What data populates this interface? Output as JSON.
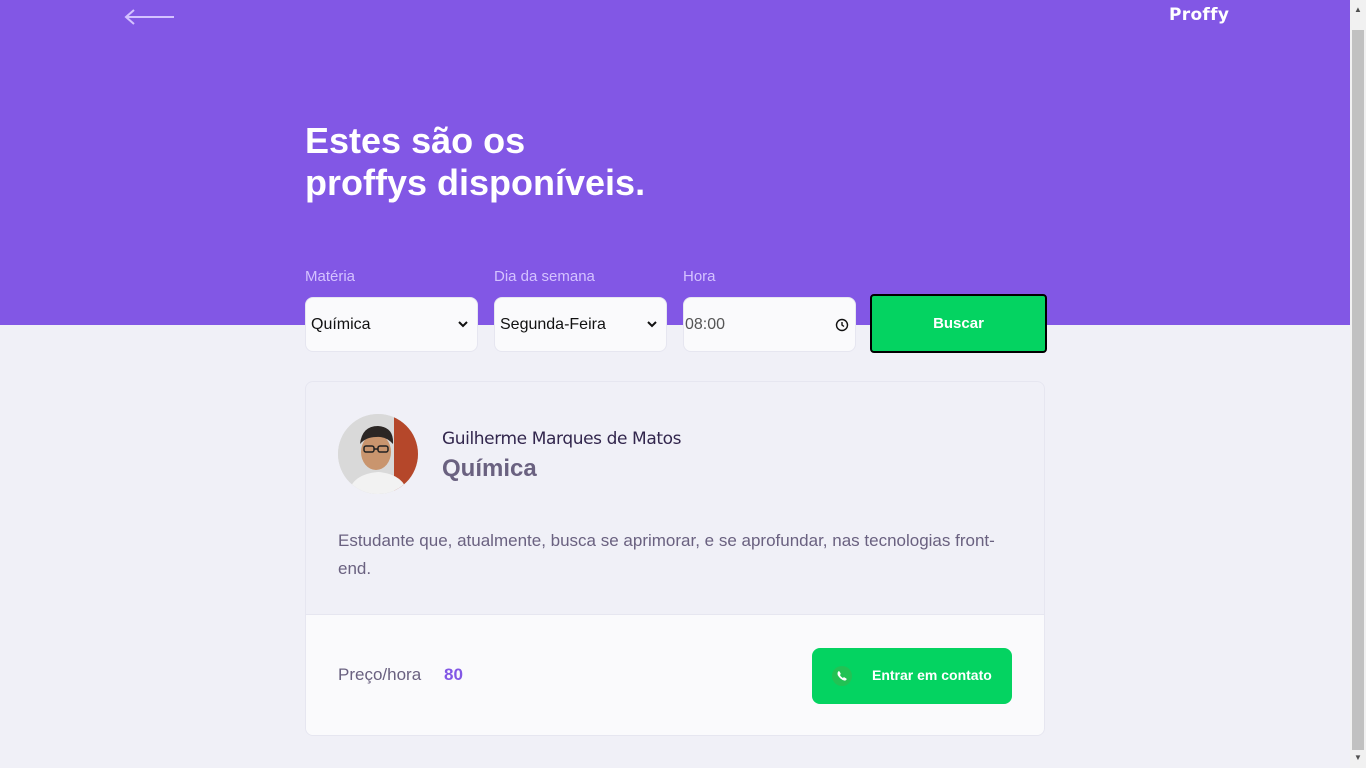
{
  "header": {
    "logo": "Proffy",
    "back_icon": "arrow-left-icon",
    "title_line1": "Estes são os",
    "title_line2": "proffys disponíveis."
  },
  "filters": {
    "subject": {
      "label": "Matéria",
      "value": "Química"
    },
    "weekday": {
      "label": "Dia da semana",
      "value": "Segunda-Feira"
    },
    "time": {
      "label": "Hora",
      "value": "08:00"
    },
    "search_label": "Buscar"
  },
  "teacher": {
    "name": "Guilherme Marques de Matos",
    "subject": "Química",
    "bio": "Estudante que, atualmente, busca se aprimorar, e se aprofundar, nas tecnologias front-end.",
    "price_label": "Preço/hora",
    "price": "80",
    "contact_label": "Entrar em contato"
  },
  "colors": {
    "primary": "#8257E5",
    "secondary": "#04D361",
    "background": "#F0F0F7",
    "text_title": "#32264D",
    "text_body": "#6A6180"
  }
}
